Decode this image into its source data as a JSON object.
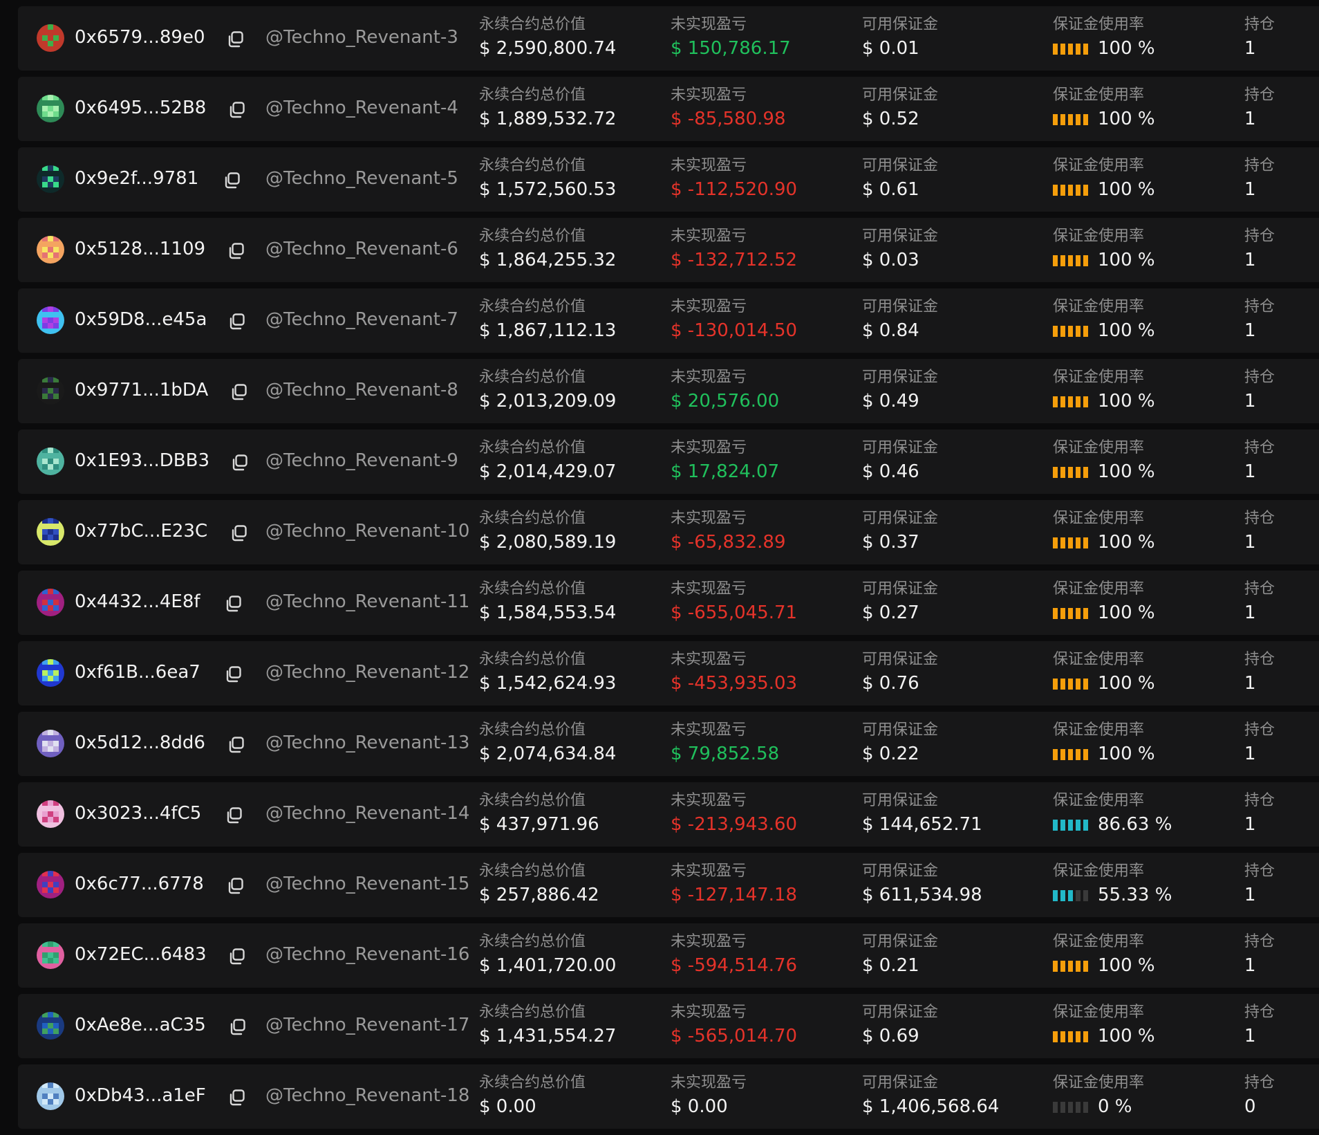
{
  "labels": {
    "perp_value": "永续合约总价值",
    "unrealized_pnl": "未实现盈亏",
    "available_margin": "可用保证金",
    "margin_usage": "保证金使用率",
    "positions": "持仓"
  },
  "colors": {
    "profit": "#20c05c",
    "loss": "#e5332a",
    "usage_full": "#f59e0b",
    "usage_partial": "#22b8c8",
    "usage_empty": "#3a3a3a"
  },
  "rows": [
    {
      "address": "0x6579...89e0",
      "handle": "@Techno_Revenant-3",
      "perp_value": "$ 2,590,800.74",
      "pnl": "$ 150,786.17",
      "pnl_sign": "pos",
      "available": "$ 0.01",
      "usage": "100 %",
      "usage_level": 1,
      "positions": "1",
      "avatar": [
        "#c0392b",
        "#3fae49",
        "#c0392b"
      ]
    },
    {
      "address": "0x6495...52B8",
      "handle": "@Techno_Revenant-4",
      "perp_value": "$ 1,889,532.72",
      "pnl": "$ -85,580.98",
      "pnl_sign": "neg",
      "available": "$ 0.52",
      "usage": "100 %",
      "usage_level": 1,
      "positions": "1",
      "avatar": [
        "#6fdc8c",
        "#2e8b57",
        "#a8f0b0"
      ]
    },
    {
      "address": "0x9e2f...9781",
      "handle": "@Techno_Revenant-5",
      "perp_value": "$ 1,572,560.53",
      "pnl": "$ -112,520.90",
      "pnl_sign": "neg",
      "available": "$ 0.61",
      "usage": "100 %",
      "usage_level": 1,
      "positions": "1",
      "avatar": [
        "#1e3a5f",
        "#39d98a",
        "#0e2a2a"
      ]
    },
    {
      "address": "0x5128...1109",
      "handle": "@Techno_Revenant-6",
      "perp_value": "$ 1,864,255.32",
      "pnl": "$ -132,712.52",
      "pnl_sign": "neg",
      "available": "$ 0.03",
      "usage": "100 %",
      "usage_level": 1,
      "positions": "1",
      "avatar": [
        "#f4a460",
        "#f7e463",
        "#e57373"
      ]
    },
    {
      "address": "0x59D8...e45a",
      "handle": "@Techno_Revenant-7",
      "perp_value": "$ 1,867,112.13",
      "pnl": "$ -130,014.50",
      "pnl_sign": "neg",
      "available": "$ 0.84",
      "usage": "100 %",
      "usage_level": 1,
      "positions": "1",
      "avatar": [
        "#7b3fe4",
        "#3fc1f0",
        "#b03fe4"
      ]
    },
    {
      "address": "0x9771...1bDA",
      "handle": "@Techno_Revenant-8",
      "perp_value": "$ 2,013,209.09",
      "pnl": "$ 20,576.00",
      "pnl_sign": "pos",
      "available": "$ 0.49",
      "usage": "100 %",
      "usage_level": 1,
      "positions": "1",
      "avatar": [
        "#2a2a4a",
        "#3a7a3a",
        "#1a1a1a"
      ]
    },
    {
      "address": "0x1E93...DBB3",
      "handle": "@Techno_Revenant-9",
      "perp_value": "$ 2,014,429.07",
      "pnl": "$ 17,824.07",
      "pnl_sign": "pos",
      "available": "$ 0.46",
      "usage": "100 %",
      "usage_level": 1,
      "positions": "1",
      "avatar": [
        "#4fb3a0",
        "#a8e6cf",
        "#2f8f7f"
      ]
    },
    {
      "address": "0x77bC...E23C",
      "handle": "@Techno_Revenant-10",
      "perp_value": "$ 2,080,589.19",
      "pnl": "$ -65,832.89",
      "pnl_sign": "neg",
      "available": "$ 0.37",
      "usage": "100 %",
      "usage_level": 1,
      "positions": "1",
      "avatar": [
        "#1c2f8a",
        "#d8e86a",
        "#3050c0"
      ]
    },
    {
      "address": "0x4432...4E8f",
      "handle": "@Techno_Revenant-11",
      "perp_value": "$ 1,584,553.54",
      "pnl": "$ -655,045.71",
      "pnl_sign": "neg",
      "available": "$ 0.27",
      "usage": "100 %",
      "usage_level": 1,
      "positions": "1",
      "avatar": [
        "#d03040",
        "#3060d0",
        "#a02080"
      ]
    },
    {
      "address": "0xf61B...6ea7",
      "handle": "@Techno_Revenant-12",
      "perp_value": "$ 1,542,624.93",
      "pnl": "$ -453,935.03",
      "pnl_sign": "neg",
      "available": "$ 0.76",
      "usage": "100 %",
      "usage_level": 1,
      "positions": "1",
      "avatar": [
        "#2038d0",
        "#b8f060",
        "#40a0f0"
      ]
    },
    {
      "address": "0x5d12...8dd6",
      "handle": "@Techno_Revenant-13",
      "perp_value": "$ 2,074,634.84",
      "pnl": "$ 79,852.58",
      "pnl_sign": "pos",
      "available": "$ 0.22",
      "usage": "100 %",
      "usage_level": 1,
      "positions": "1",
      "avatar": [
        "#c0b0e0",
        "#7060c0",
        "#e0e0f0"
      ]
    },
    {
      "address": "0x3023...4fC5",
      "handle": "@Techno_Revenant-14",
      "perp_value": "$ 437,971.96",
      "pnl": "$ -213,943.60",
      "pnl_sign": "neg",
      "available": "$ 144,652.71",
      "usage": "86.63 %",
      "usage_level": 0.8663,
      "positions": "1",
      "avatar": [
        "#e8a0d0",
        "#d04080",
        "#f0c0e0"
      ]
    },
    {
      "address": "0x6c77...6778",
      "handle": "@Techno_Revenant-15",
      "perp_value": "$ 257,886.42",
      "pnl": "$ -127,147.18",
      "pnl_sign": "neg",
      "available": "$ 611,534.98",
      "usage": "55.33 %",
      "usage_level": 0.5533,
      "positions": "1",
      "avatar": [
        "#a02080",
        "#4040c0",
        "#e03050"
      ]
    },
    {
      "address": "0x72EC...6483",
      "handle": "@Techno_Revenant-16",
      "perp_value": "$ 1,401,720.00",
      "pnl": "$ -594,514.76",
      "pnl_sign": "neg",
      "available": "$ 0.21",
      "usage": "100 %",
      "usage_level": 1,
      "positions": "1",
      "avatar": [
        "#40c090",
        "#e060a0",
        "#30a070"
      ]
    },
    {
      "address": "0xAe8e...aC35",
      "handle": "@Techno_Revenant-17",
      "perp_value": "$ 1,431,554.27",
      "pnl": "$ -565,014.70",
      "pnl_sign": "neg",
      "available": "$ 0.69",
      "usage": "100 %",
      "usage_level": 1,
      "positions": "1",
      "avatar": [
        "#2060c0",
        "#40a060",
        "#1a3a80"
      ]
    },
    {
      "address": "0xDb43...a1eF",
      "handle": "@Techno_Revenant-18",
      "perp_value": "$ 0.00",
      "pnl": "$ 0.00",
      "pnl_sign": "zero",
      "available": "$ 1,406,568.64",
      "usage": "0 %",
      "usage_level": 0,
      "positions": "0",
      "avatar": [
        "#a0c8e8",
        "#5080c0",
        "#d0e8f8"
      ]
    }
  ]
}
